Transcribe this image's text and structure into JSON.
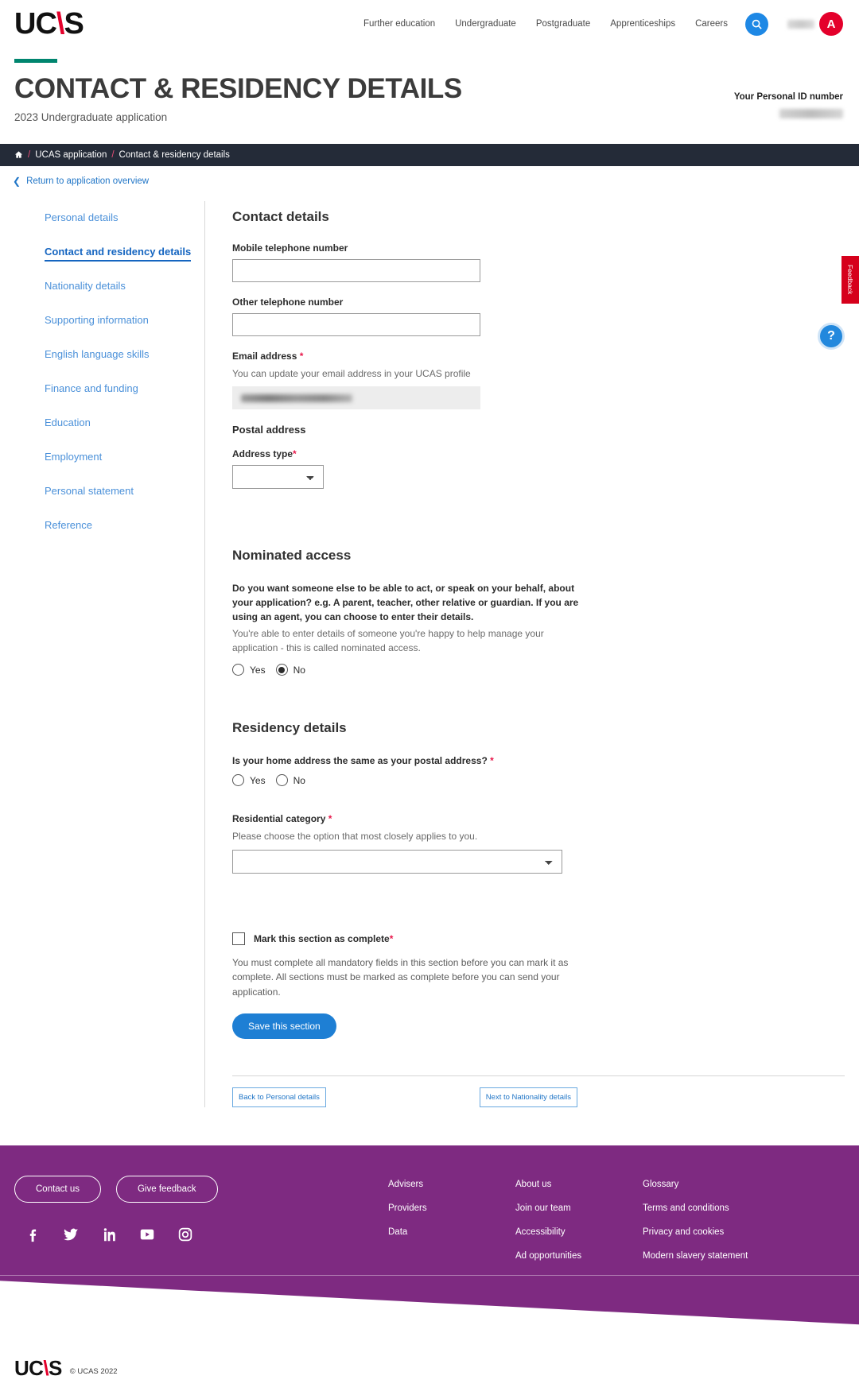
{
  "header": {
    "logo_text": "UC",
    "logo_slash": "\\",
    "logo_tail": "S",
    "nav": [
      {
        "label": "Further education"
      },
      {
        "label": "Undergraduate"
      },
      {
        "label": "Postgraduate"
      },
      {
        "label": "Apprenticeships"
      },
      {
        "label": "Careers"
      }
    ],
    "search_icon": "search-icon",
    "avatar_initial": "A"
  },
  "page": {
    "title": "CONTACT & RESIDENCY DETAILS",
    "subtitle": "2023 Undergraduate application",
    "personal_id_label": "Your Personal ID number"
  },
  "breadcrumb": {
    "home_icon": "home-icon",
    "sep": "/",
    "items": [
      {
        "label": "UCAS application"
      },
      {
        "label": "Contact & residency details"
      }
    ]
  },
  "return_link": {
    "label": "Return to application overview",
    "icon": "chevron-left-icon"
  },
  "sidebar": {
    "items": [
      {
        "label": "Personal details",
        "active": false
      },
      {
        "label": "Contact and residency details",
        "active": true
      },
      {
        "label": "Nationality details",
        "active": false
      },
      {
        "label": "Supporting information",
        "active": false
      },
      {
        "label": "English language skills",
        "active": false
      },
      {
        "label": "Finance and funding",
        "active": false
      },
      {
        "label": "Education",
        "active": false
      },
      {
        "label": "Employment",
        "active": false
      },
      {
        "label": "Personal statement",
        "active": false
      },
      {
        "label": "Reference",
        "active": false
      }
    ]
  },
  "contact_details": {
    "heading": "Contact details",
    "mobile_label": "Mobile telephone number",
    "mobile_value": "",
    "other_label": "Other telephone number",
    "other_value": "",
    "email_label": "Email address",
    "email_required": "*",
    "email_hint": "You can update your email address in your UCAS profile",
    "postal_address_heading": "Postal address",
    "address_type_label": "Address type",
    "address_type_required": "*",
    "address_type_value": ""
  },
  "nominated_access": {
    "heading": "Nominated access",
    "question": "Do you want someone else to be able to act, or speak on your behalf, about your application? e.g. A parent, teacher, other relative or guardian. If you are using an agent, you can choose to enter their details.",
    "hint": "You're able to enter details of someone you're happy to help manage your application - this is called nominated access.",
    "options": [
      {
        "label": "Yes",
        "selected": false
      },
      {
        "label": "No",
        "selected": true
      }
    ]
  },
  "residency_details": {
    "heading": "Residency details",
    "same_address_question": "Is your home address the same as your postal address?",
    "same_address_required": "*",
    "same_address_options": [
      {
        "label": "Yes",
        "selected": false
      },
      {
        "label": "No",
        "selected": false
      }
    ],
    "residential_category_label": "Residential category",
    "residential_category_required": "*",
    "residential_category_hint": "Please choose the option that most closely applies to you.",
    "residential_category_value": ""
  },
  "completion": {
    "checkbox_label": "Mark this section as complete",
    "checkbox_required": "*",
    "checkbox_checked": false,
    "note": "You must complete all mandatory fields in this section before you can mark it as complete. All sections must be marked as complete before you can send your application.",
    "save_label": "Save this section"
  },
  "pager": {
    "back_label": "Back to Personal details",
    "next_label": "Next to Nationality details"
  },
  "widgets": {
    "feedback_label": "Feedback",
    "help_label": "?"
  },
  "footer": {
    "contact_button": "Contact us",
    "feedback_button": "Give feedback",
    "social": [
      {
        "name": "facebook-icon"
      },
      {
        "name": "twitter-icon"
      },
      {
        "name": "linkedin-icon"
      },
      {
        "name": "youtube-icon"
      },
      {
        "name": "instagram-icon"
      }
    ],
    "columns": [
      {
        "links": [
          {
            "label": "Advisers"
          },
          {
            "label": "Providers"
          },
          {
            "label": "Data"
          }
        ]
      },
      {
        "links": [
          {
            "label": "About us"
          },
          {
            "label": "Join our team"
          },
          {
            "label": "Accessibility"
          },
          {
            "label": "Ad opportunities"
          }
        ]
      },
      {
        "links": [
          {
            "label": "Glossary"
          },
          {
            "label": "Terms and conditions"
          },
          {
            "label": "Privacy and cookies"
          },
          {
            "label": "Modern slavery statement"
          }
        ]
      }
    ],
    "copyright": "© UCAS 2022"
  },
  "colors": {
    "brand_red": "#e4002b",
    "teal_rule": "#00856f",
    "breadcrumb_bg": "#242b38",
    "link_blue": "#2176c7",
    "footer_purple": "#7e2a81",
    "primary_button": "#1e7fd4"
  }
}
